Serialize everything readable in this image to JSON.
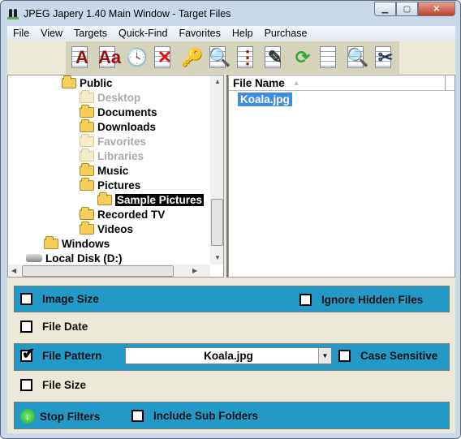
{
  "window": {
    "title": "JPEG Japery 1.40 Main Window - Target Files"
  },
  "menu": [
    "File",
    "View",
    "Targets",
    "Quick-Find",
    "Favorites",
    "Help",
    "Purchase"
  ],
  "toolbar": [
    {
      "icon": "doc-font-a-icon",
      "glyph": "A",
      "color": "#9a1010"
    },
    {
      "icon": "doc-font-aa-icon",
      "glyph": "Aa",
      "color": "#9a1010"
    },
    {
      "icon": "clock-icon",
      "glyph": "🕓",
      "color": "#555"
    },
    {
      "icon": "doc-delete-icon",
      "glyph": "✕",
      "color": "#e01010"
    },
    {
      "icon": "key-icon",
      "glyph": "🔑",
      "color": "#c9a000"
    },
    {
      "icon": "doc-search-icon",
      "glyph": "🔍",
      "color": "#236"
    },
    {
      "icon": "doc-list-icon",
      "glyph": "⋮",
      "color": "#a00"
    },
    {
      "icon": "doc-edit-icon",
      "glyph": "✎",
      "color": "#333"
    },
    {
      "icon": "refresh-icon",
      "glyph": "⟳",
      "color": "#3a3"
    },
    {
      "icon": "docs-copy-icon",
      "glyph": "",
      "color": "#333"
    },
    {
      "icon": "docs-search-icon",
      "glyph": "🔍",
      "color": "#236"
    },
    {
      "icon": "doc-cut-icon",
      "glyph": "✂",
      "color": "#236"
    }
  ],
  "tree": [
    {
      "label": "Public",
      "level": 2,
      "dim": false
    },
    {
      "label": "Desktop",
      "level": 3,
      "dim": true
    },
    {
      "label": "Documents",
      "level": 3,
      "dim": false
    },
    {
      "label": "Downloads",
      "level": 3,
      "dim": false
    },
    {
      "label": "Favorites",
      "level": 3,
      "dim": true
    },
    {
      "label": "Libraries",
      "level": 3,
      "dim": true
    },
    {
      "label": "Music",
      "level": 3,
      "dim": false
    },
    {
      "label": "Pictures",
      "level": 3,
      "dim": false
    },
    {
      "label": "Sample Pictures",
      "level": 4,
      "dim": false,
      "selected": true
    },
    {
      "label": "Recorded TV",
      "level": 3,
      "dim": false
    },
    {
      "label": "Videos",
      "level": 3,
      "dim": false
    },
    {
      "label": "Windows",
      "level": 1,
      "dim": false
    },
    {
      "label": "Local Disk (D:)",
      "level": 0,
      "dim": false,
      "disk": true
    }
  ],
  "filelist": {
    "header": "File Name",
    "items": [
      "Koala.jpg"
    ]
  },
  "filters": {
    "image_size": {
      "label": "Image Size",
      "checked": false
    },
    "ignore_hidden": {
      "label": "Ignore Hidden Files",
      "checked": false
    },
    "file_date": {
      "label": "File Date",
      "checked": false
    },
    "file_pattern": {
      "label": "File Pattern",
      "checked": true,
      "value": "Koala.jpg"
    },
    "case_sensitive": {
      "label": "Case Sensitive",
      "checked": false
    },
    "file_size": {
      "label": "File Size",
      "checked": false
    },
    "stop_filters": "Stop Filters",
    "include_sub": {
      "label": "Include Sub Folders",
      "checked": false
    }
  },
  "colors": {
    "filter_bar": "#2399c8",
    "selection": "#3d8ee0"
  }
}
